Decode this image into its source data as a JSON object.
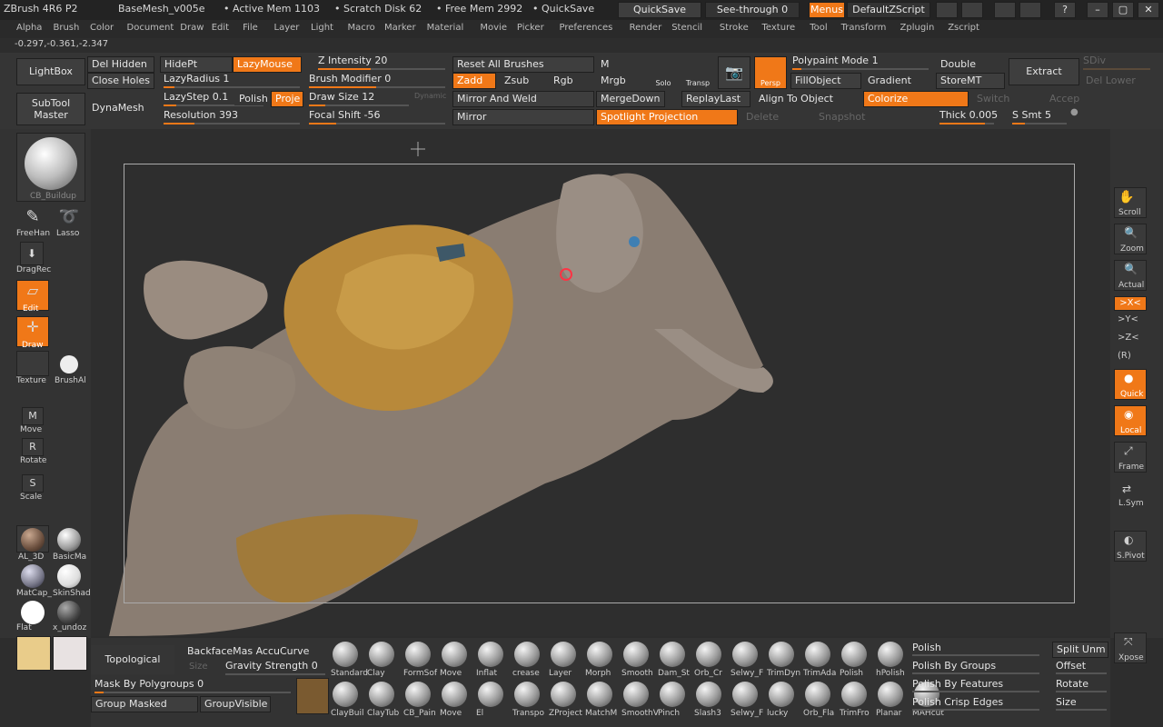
{
  "title": {
    "app": "ZBrush 4R6 P2",
    "file": "BaseMesh_v005e",
    "active_mem": "• Active Mem 1103",
    "scratch": "• Scratch Disk 62",
    "free_mem": "• Free Mem 2992",
    "quicksave": "• QuickSave",
    "quicksave_btn": "QuickSave",
    "seethrough": "See-through  0",
    "menus": "Menus",
    "script": "DefaultZScript"
  },
  "menus": [
    "Alpha",
    "Brush",
    "Color",
    "Document",
    "Draw",
    "Edit",
    "File",
    "Layer",
    "Light",
    "Macro",
    "Marker",
    "Material",
    "Movie",
    "Picker",
    "Preferences",
    "Render",
    "Stencil",
    "Stroke",
    "Texture",
    "Tool",
    "Transform",
    "Zplugin",
    "Zscript"
  ],
  "coords": "-0.297,-0.361,-2.347",
  "top": {
    "lightbox": "LightBox",
    "subtool": "SubTool\nMaster",
    "del_hidden": "Del Hidden",
    "close_holes": "Close Holes",
    "dynamesh": "DynaMesh",
    "hidept": "HidePt",
    "lazymouse": "LazyMouse",
    "lazyradius": "LazyRadius 1",
    "lazystep": "LazyStep 0.1",
    "polish": "Polish",
    "proj": "Proje",
    "resolution": "Resolution 393",
    "z_intensity": "Z Intensity 20",
    "brush_modifier": "Brush Modifier 0",
    "draw_size": "Draw Size 12",
    "dynamic": "Dynamic",
    "focal_shift": "Focal Shift -56",
    "reset_brushes": "Reset All Brushes",
    "zadd": "Zadd",
    "zsub": "Zsub",
    "rgb": "Rgb",
    "mirror_weld": "Mirror And Weld",
    "mirror": "Mirror",
    "m": "M",
    "mrgb": "Mrgb",
    "mergedown": "MergeDown",
    "replaylast": "ReplayLast",
    "spotlight": "Spotlight Projection",
    "delete": "Delete",
    "solo": "Solo",
    "transp": "Transp",
    "persp": "Persp",
    "polypaint": "Polypaint Mode 1",
    "fillobject": "FillObject",
    "gradient": "Gradient",
    "align": "Align To Object",
    "colorize": "Colorize",
    "snapshot": "Snapshot",
    "double": "Double",
    "storemt": "StoreMT",
    "switch": "Switch",
    "thick": "Thick 0.005",
    "ssmt": "S Smt 5",
    "extract": "Extract",
    "accept": "Accep",
    "sdiv": "SDiv",
    "dellower": "Del Lower"
  },
  "left": {
    "brush_name": "CB_Buildup",
    "freehand": "FreeHan",
    "lasso": "Lasso",
    "dragrect": "DragRec",
    "edit": "Edit",
    "draw": "Draw",
    "texture": "Texture",
    "brushalpha": "BrushAl",
    "move": "Move",
    "rotate": "Rotate",
    "scale": "Scale",
    "materials": [
      "AL_3D",
      "BasicMa",
      "MatCap_",
      "SkinShad",
      "Flat",
      "x_undoz"
    ]
  },
  "right": {
    "scroll": "Scroll",
    "zoom": "Zoom",
    "actual": "Actual",
    "x": ">X<",
    "y": ">Y<",
    "z": ">Z<",
    "r": "(R)",
    "quick": "Quick",
    "local": "Local",
    "frame": "Frame",
    "lsym": "L.Sym",
    "spivot": "S.Pivot",
    "xpose": "Xpose"
  },
  "bottom": {
    "topological": "Topological",
    "size": "Size",
    "backface": "BackfaceMas AccuCurve",
    "gravity": "Gravity Strength 0",
    "mask_polygroups": "Mask By Polygroups 0",
    "group_masked": "Group Masked",
    "group_visible": "GroupVisible",
    "brushes_row1": [
      "Standard",
      "Clay",
      "FormSof",
      "Move",
      "Inflat",
      "crease",
      "Layer",
      "Morph",
      "Smooth",
      "Dam_St",
      "Orb_Cr",
      "Selwy_F",
      "TrimDyn",
      "TrimAda",
      "Polish",
      "hPolish"
    ],
    "brushes_row2": [
      "ClayBuil",
      "ClayTub",
      "CB_Pain",
      "Move",
      "El",
      "Transpo",
      "ZProject",
      "MatchM",
      "SmoothV",
      "Pinch",
      "Slash3",
      "Selwy_F",
      "lucky",
      "Orb_Fla",
      "TrimFro",
      "Planar",
      "MAHcut"
    ],
    "polish": "Polish",
    "polish_groups": "Polish By Groups",
    "polish_features": "Polish By Features",
    "polish_crisp": "Polish Crisp Edges",
    "split": "Split Unm",
    "offset": "Offset",
    "rotate": "Rotate",
    "size2": "Size"
  },
  "colors": {
    "accent": "#f07818",
    "panel": "#353535",
    "viewport": "#2e2e2e"
  }
}
